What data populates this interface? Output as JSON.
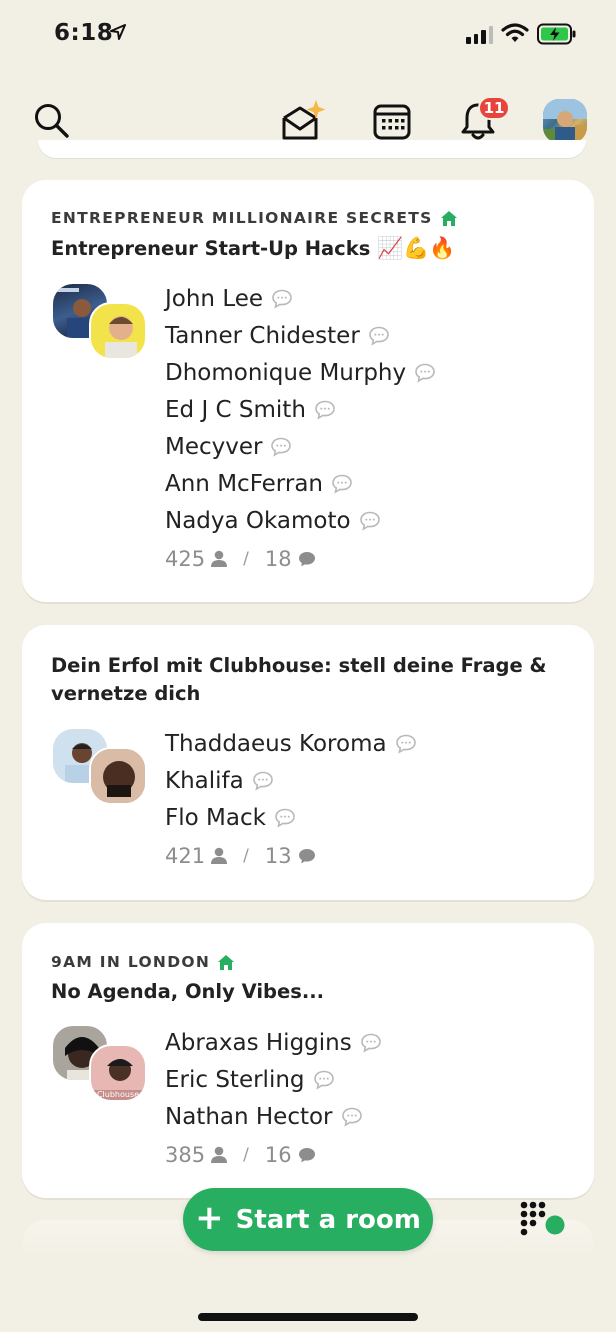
{
  "status_bar": {
    "time": "6:18"
  },
  "header": {
    "notification_count": "11"
  },
  "rooms": [
    {
      "club": "ENTREPRENEUR MILLIONAIRE SECRETS",
      "title": "Entrepreneur Start-Up Hacks",
      "title_emoji": "📈💪🔥",
      "speakers": [
        "John Lee",
        "Tanner Chidester",
        "Dhomonique Murphy",
        "Ed J C Smith",
        "Mecyver",
        "Ann McFerran",
        "Nadya Okamoto"
      ],
      "listeners": "425",
      "comments": "18"
    },
    {
      "club": "",
      "title": "Dein Erfol mit Clubhouse: stell deine Frage & vernetze dich",
      "speakers": [
        "Thaddaeus Koroma",
        "Khalifa",
        "Flo Mack"
      ],
      "listeners": "421",
      "comments": "13"
    },
    {
      "club": "9AM IN LONDON",
      "title": "No Agenda, Only Vibes...",
      "speakers": [
        "Abraxas Higgins",
        "Eric Sterling",
        "Nathan Hector"
      ],
      "listeners": "385",
      "comments": "16",
      "avatar_caption": "Clubhouse"
    }
  ],
  "start_room_label": "Start a room",
  "start_room_icon": "+",
  "colors": {
    "accent": "#27ae60",
    "badge": "#e8443b",
    "background": "#f2efe4"
  },
  "icons": [
    "search-icon",
    "invite-envelope-icon",
    "calendar-icon",
    "bell-icon",
    "house-icon",
    "speech-bubble-icon",
    "person-icon",
    "comment-icon",
    "grid-dots-icon"
  ]
}
